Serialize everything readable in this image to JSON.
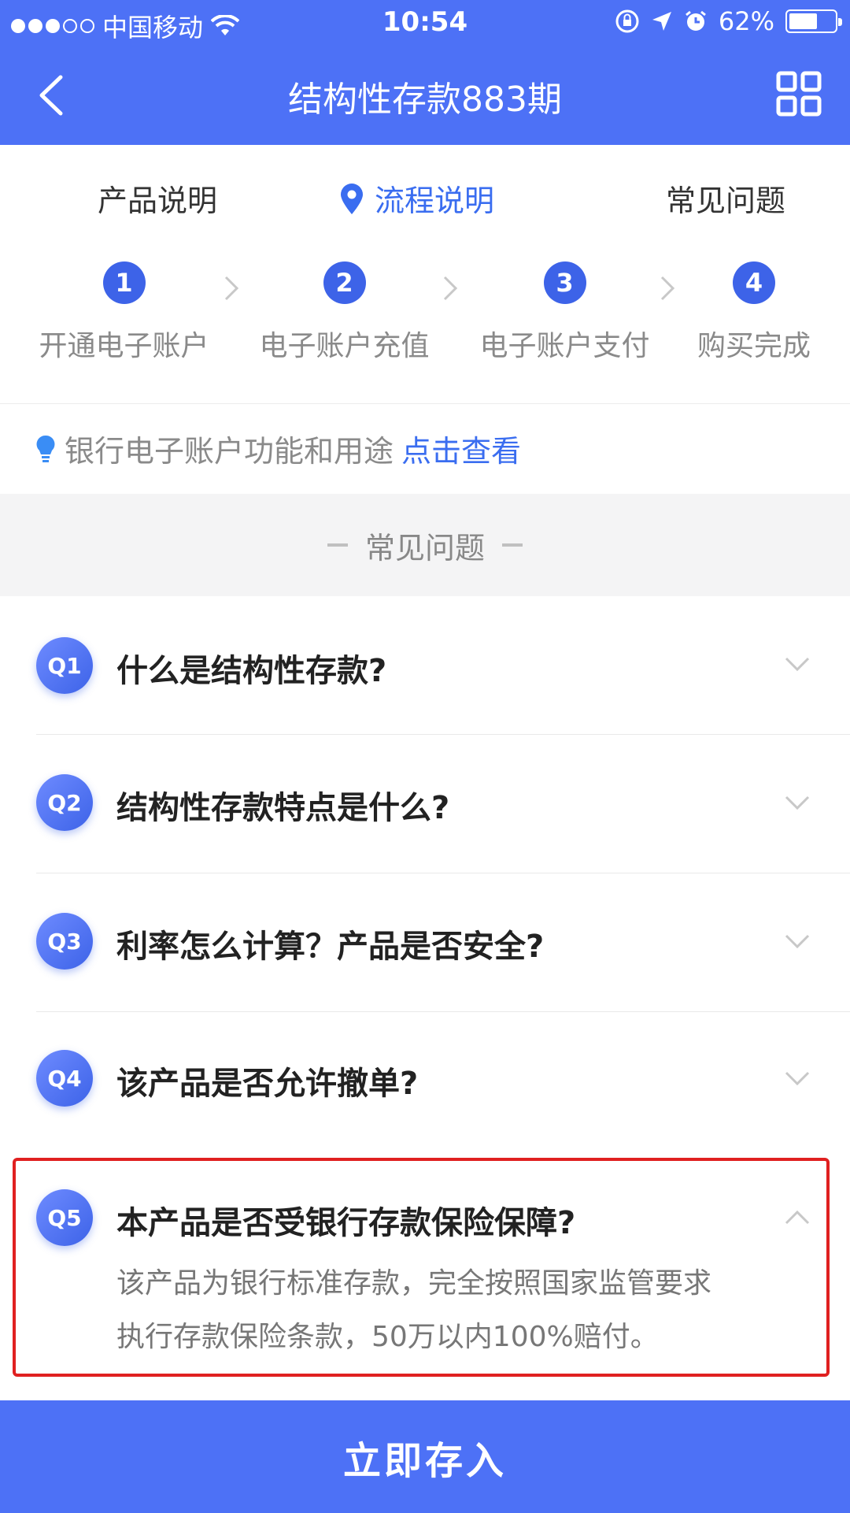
{
  "status_bar": {
    "carrier": "中国移动",
    "time": "10:54",
    "battery": "62%",
    "battery_level": 0.62
  },
  "nav": {
    "title": "结构性存款883期",
    "back_icon": "chevron-left-icon",
    "menu_icon": "grid-icon"
  },
  "tabs": [
    {
      "label": "产品说明",
      "active": false
    },
    {
      "label": "流程说明",
      "active": true,
      "icon": "location-pin-icon"
    },
    {
      "label": "常见问题",
      "active": false
    }
  ],
  "steps": [
    {
      "number": "1",
      "label": "开通电子账户"
    },
    {
      "number": "2",
      "label": "电子账户充值"
    },
    {
      "number": "3",
      "label": "电子账户支付"
    },
    {
      "number": "4",
      "label": "购买完成"
    }
  ],
  "info_link": {
    "text": "银行电子账户功能和用途",
    "link": "点击查看"
  },
  "faq_section": {
    "title": "常见问题",
    "items": [
      {
        "badge": "Q1",
        "question": "什么是结构性存款?",
        "expanded": false
      },
      {
        "badge": "Q2",
        "question": "结构性存款特点是什么?",
        "expanded": false
      },
      {
        "badge": "Q3",
        "question": "利率怎么计算？产品是否安全?",
        "expanded": false
      },
      {
        "badge": "Q4",
        "question": "该产品是否允许撤单?",
        "expanded": false
      },
      {
        "badge": "Q5",
        "question": "本产品是否受银行存款保险保障?",
        "expanded": true,
        "answer_lines": [
          "该产品为银行标准存款，完全按照国家监管要求",
          "执行存款保险条款，50万以内100%赔付。"
        ]
      }
    ]
  },
  "cta": {
    "label": "立即存入"
  },
  "colors": {
    "brand_blue": "#4d71f6",
    "step_blue": "#3d63e8",
    "link_blue": "#3a6df0",
    "highlight_red": "#e02020"
  }
}
